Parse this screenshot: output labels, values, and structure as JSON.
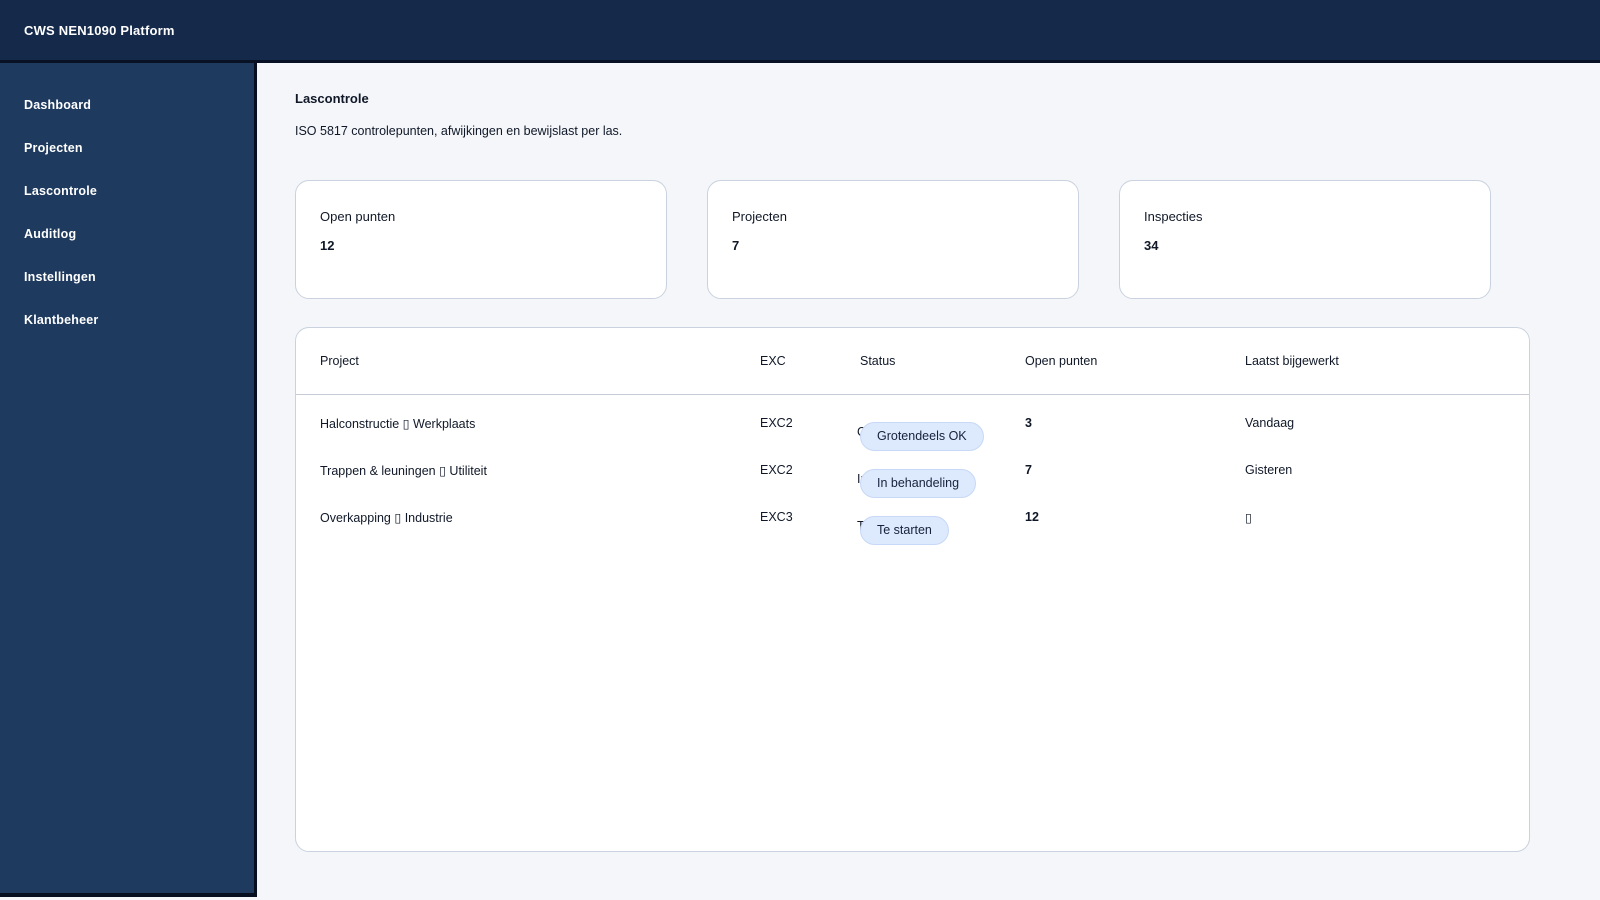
{
  "app": {
    "title": "CWS NEN1090 Platform"
  },
  "sidebar": {
    "items": [
      {
        "label": "Dashboard"
      },
      {
        "label": "Projecten"
      },
      {
        "label": "Lascontrole"
      },
      {
        "label": "Auditlog"
      },
      {
        "label": "Instellingen"
      },
      {
        "label": "Klantbeheer"
      }
    ]
  },
  "page": {
    "title": "Lascontrole",
    "subtitle": "ISO 5817 controlepunten, afwijkingen en bewijslast per las."
  },
  "stats": [
    {
      "label": "Open punten",
      "value": "12"
    },
    {
      "label": "Projecten",
      "value": "7"
    },
    {
      "label": "Inspecties",
      "value": "34"
    }
  ],
  "table": {
    "columns": [
      "Project",
      "EXC",
      "Status",
      "Open punten",
      "Laatst bijgewerkt"
    ],
    "rows": [
      {
        "project": "Halconstructie ▯ Werkplaats",
        "exc": "EXC2",
        "status": "Grotendeels OK",
        "open_punten": "3",
        "laatst_bijgewerkt": "Vandaag"
      },
      {
        "project": "Trappen & leuningen ▯ Utiliteit",
        "exc": "EXC2",
        "status": "In behandeling",
        "open_punten": "7",
        "laatst_bijgewerkt": "Gisteren"
      },
      {
        "project": "Overkapping ▯ Industrie",
        "exc": "EXC3",
        "status": "Te starten",
        "open_punten": "12",
        "laatst_bijgewerkt": "▯"
      }
    ]
  },
  "colors": {
    "topbar_bg": "#15294b",
    "sidebar_bg": "#1e3a5e",
    "main_bg": "#f4f6f9",
    "card_border": "#c9d2de",
    "status_pill_bg": "#dde9fc",
    "status_pill_border": "#c7d9f6",
    "text_primary": "#101828",
    "text_on_dark": "#ffffff"
  }
}
